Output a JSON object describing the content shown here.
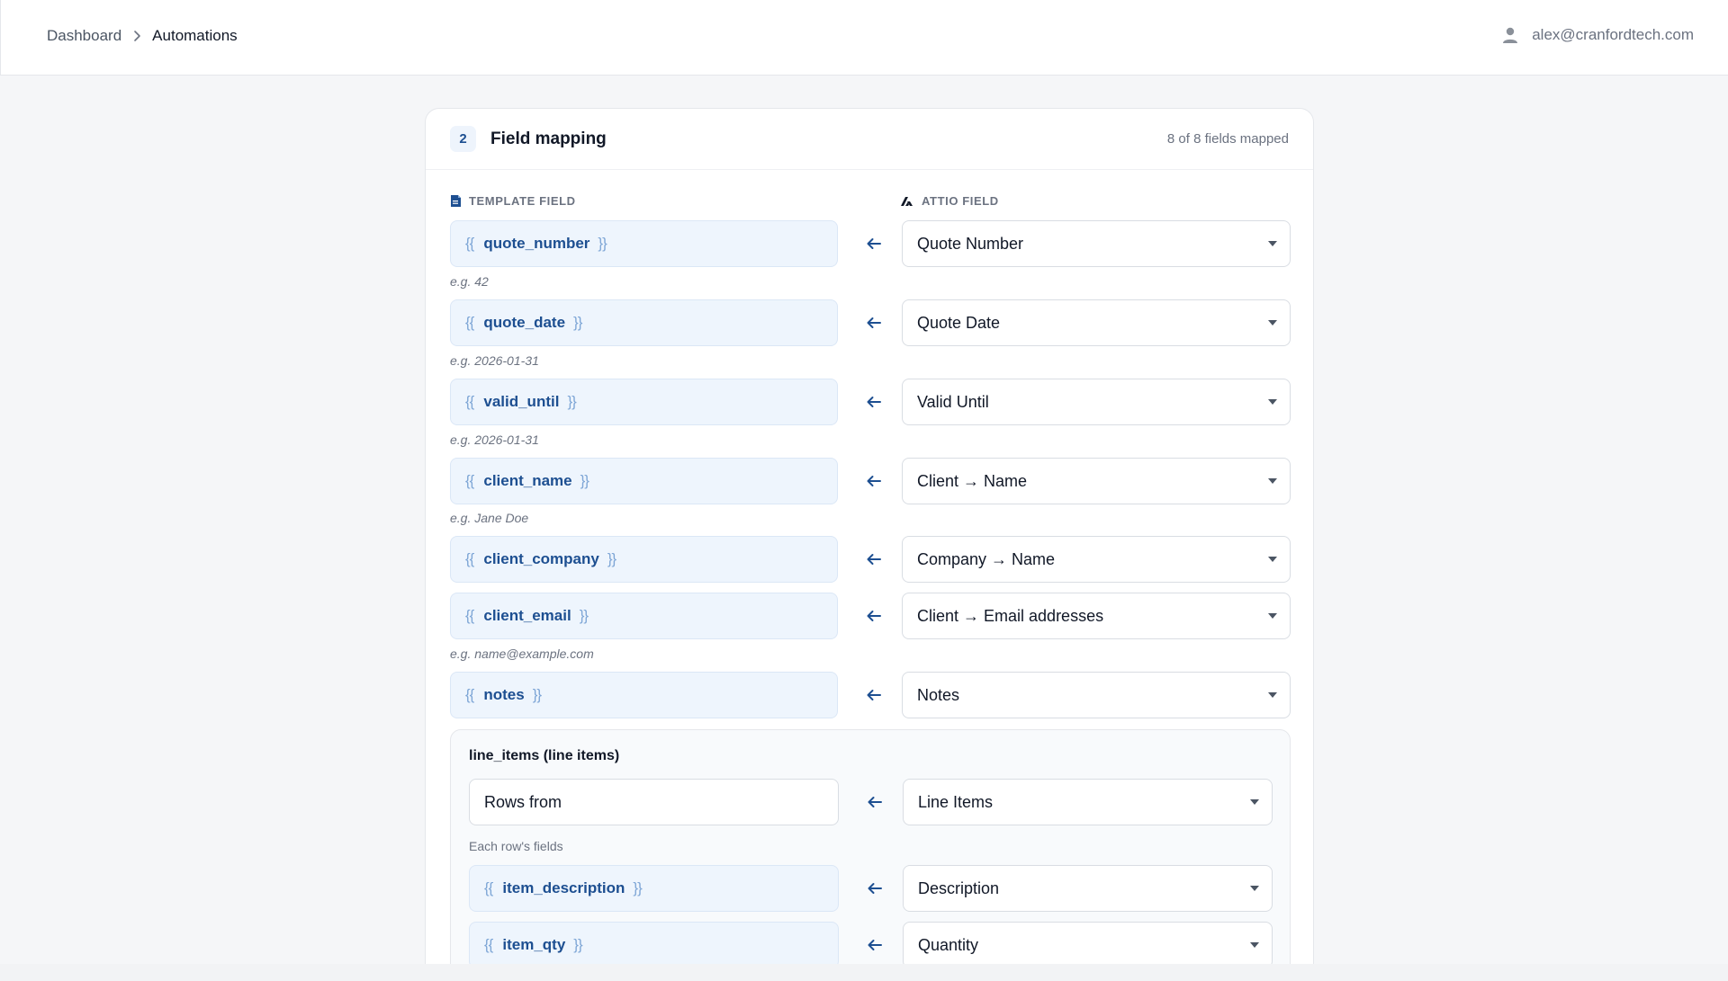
{
  "breadcrumb": {
    "parent": "Dashboard",
    "current": "Automations"
  },
  "user": {
    "email": "alex@cranfordtech.com",
    "icon": "user-icon"
  },
  "card": {
    "step_number": "2",
    "title": "Field mapping",
    "mapped_count": "8 of 8 fields mapped"
  },
  "columns": {
    "template_label": "TEMPLATE FIELD",
    "template_icon": "document-icon",
    "attio_label": "ATTIO FIELD",
    "attio_icon": "attio-logo-icon"
  },
  "braces": {
    "open": "{{",
    "close": "}}"
  },
  "mappings": [
    {
      "template_field": "quote_number",
      "attio_field": "Quote Number",
      "example": "e.g. 42"
    },
    {
      "template_field": "quote_date",
      "attio_field": "Quote Date",
      "example": "e.g. 2026-01-31"
    },
    {
      "template_field": "valid_until",
      "attio_field": "Valid Until",
      "example": "e.g. 2026-01-31"
    },
    {
      "template_field": "client_name",
      "attio_field": "Client → Name",
      "example": "e.g. Jane Doe"
    },
    {
      "template_field": "client_company",
      "attio_field": "Company → Name",
      "example": ""
    },
    {
      "template_field": "client_email",
      "attio_field": "Client → Email addresses",
      "example": "e.g. name@example.com"
    },
    {
      "template_field": "notes",
      "attio_field": "Notes",
      "example": ""
    }
  ],
  "line_items": {
    "title": "line_items (line items)",
    "rows_from_label": "Rows from",
    "rows_from_value": "Line Items",
    "row_fields_label": "Each row's fields",
    "fields": [
      {
        "template_field": "item_description",
        "attio_field": "Description"
      },
      {
        "template_field": "item_qty",
        "attio_field": "Quantity"
      }
    ]
  },
  "colors": {
    "accent": "#1d4f91",
    "template_bg": "#eef5fd",
    "brace": "#7ea6d6",
    "page_bg": "#f5f6f8"
  }
}
